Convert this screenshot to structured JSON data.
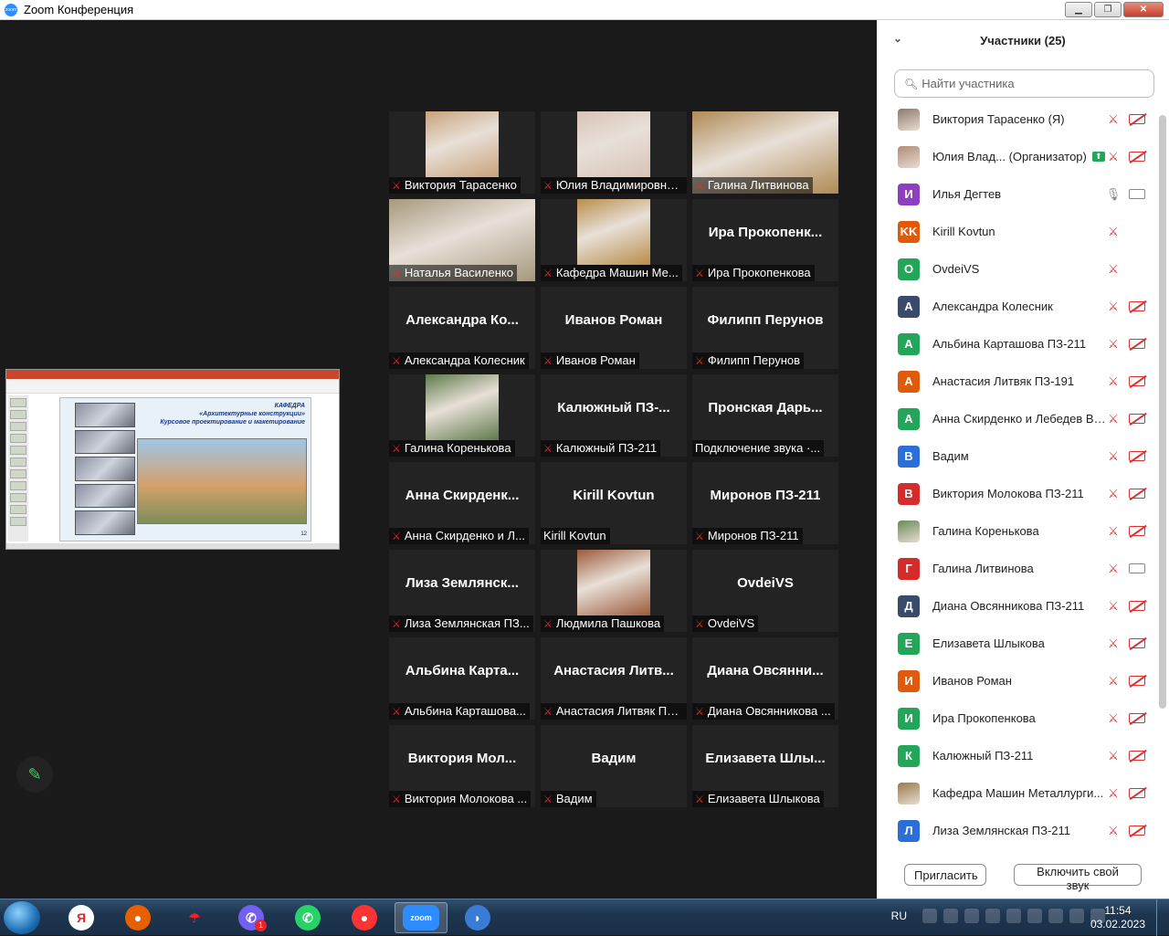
{
  "window": {
    "title": "Zoom Конференция",
    "app_icon_text": "zoom"
  },
  "shared_screen": {
    "slide_header": "КАФЕДРА",
    "slide_title": "«Архитектурные конструкции»",
    "slide_subtitle": "Курсовое проектирование и макетирование",
    "slide_number": "12"
  },
  "gallery": [
    {
      "label": "Виктория Тарасенко",
      "muted": true,
      "photo": "#c9a27a",
      "full": false
    },
    {
      "label": "Юлия Владимировна...",
      "muted": true,
      "photo": "#d8c3b6",
      "full": false
    },
    {
      "label": "Галина Литвинова",
      "muted": true,
      "photo": "#b08a55",
      "full": true
    },
    {
      "label": "Наталья Василенко",
      "muted": true,
      "photo": "#a6987e",
      "full": true
    },
    {
      "label": "Кафедра Машин Ме...",
      "muted": true,
      "photo": "#b98d4a",
      "full": false
    },
    {
      "name": "Ира  Прокопенк...",
      "label": "Ира Прокопенкова",
      "muted": true
    },
    {
      "name": "Александра  Ко...",
      "label": "Александра Колесник",
      "muted": true
    },
    {
      "name": "Иванов Роман",
      "label": "Иванов Роман",
      "muted": true
    },
    {
      "name": "Филипп Перунов",
      "label": "Филипп Перунов",
      "muted": true
    },
    {
      "label": "Галина Коренькова",
      "muted": true,
      "photo": "#5e7a4a",
      "full": false
    },
    {
      "name": "Калюжный  ПЗ-...",
      "label": "Калюжный ПЗ-211",
      "muted": true
    },
    {
      "name": "Пронская  Дарь...",
      "label": "Подключение звука ·...",
      "muted": false
    },
    {
      "name": "Анна  Скирденк...",
      "label": "Анна Скирденко и Л...",
      "muted": true
    },
    {
      "name": "Kirill Kovtun",
      "label": "Kirill Kovtun",
      "muted": false
    },
    {
      "name": "Миронов ПЗ-211",
      "label": "Миронов ПЗ-211",
      "muted": true
    },
    {
      "name": "Лиза  Землянск...",
      "label": "Лиза Землянская ПЗ...",
      "muted": true
    },
    {
      "label": "Людмила Пашкова",
      "muted": true,
      "photo": "#9b5a3a",
      "full": false
    },
    {
      "name": "OvdeiVS",
      "label": "OvdeiVS",
      "muted": true
    },
    {
      "name": "Альбина  Карта...",
      "label": "Альбина Карташова...",
      "muted": true
    },
    {
      "name": "Анастасия  Литв...",
      "label": "Анастасия Литвяк ПЗ...",
      "muted": true
    },
    {
      "name": "Диана  Овсянни...",
      "label": "Диана Овсянникова ...",
      "muted": true
    },
    {
      "name": "Виктория  Мол...",
      "label": "Виктория Молокова ...",
      "muted": true
    },
    {
      "name": "Вадим",
      "label": "Вадим",
      "muted": true
    },
    {
      "name": "Елизавета  Шлы...",
      "label": "Елизавета Шлыкова",
      "muted": true
    }
  ],
  "panel": {
    "title": "Участники (25)",
    "search_placeholder": "Найти участника",
    "invite_label": "Пригласить",
    "unmute_label": "Включить свой звук",
    "participants": [
      {
        "initials": "",
        "photo": "#8a7a6a",
        "name": "Виктория Тарасенко (Я)",
        "mic": "off",
        "cam": "off"
      },
      {
        "initials": "",
        "photo": "#b08c7a",
        "name": "Юлия Влад...  (Организатор)",
        "share": true,
        "mic": "off",
        "cam": "off"
      },
      {
        "initials": "И",
        "color": "#8e3fc0",
        "name": "Илья Дегтев",
        "mic": "on",
        "cam": "on"
      },
      {
        "initials": "KK",
        "color": "#e05a0c",
        "name": "Kirill Kovtun",
        "mic": "off",
        "cam": "none"
      },
      {
        "initials": "O",
        "color": "#23a55a",
        "name": "OvdeiVS",
        "mic": "off",
        "cam": "none"
      },
      {
        "initials": "А",
        "color": "#3a4a6a",
        "name": "Александра Колесник",
        "mic": "off",
        "cam": "off"
      },
      {
        "initials": "А",
        "color": "#23a55a",
        "name": "Альбина Карташова ПЗ-211",
        "mic": "off",
        "cam": "off"
      },
      {
        "initials": "А",
        "color": "#e05a0c",
        "name": "Анастасия Литвяк ПЗ-191",
        "mic": "off",
        "cam": "off"
      },
      {
        "initials": "А",
        "color": "#23a55a",
        "name": "Анна Скирденко и Лебедев Ви...",
        "mic": "off",
        "cam": "off"
      },
      {
        "initials": "В",
        "color": "#2b6fd6",
        "name": "Вадим",
        "mic": "off",
        "cam": "off"
      },
      {
        "initials": "В",
        "color": "#d62b2b",
        "name": "Виктория Молокова ПЗ-211",
        "mic": "off",
        "cam": "off"
      },
      {
        "initials": "",
        "photo": "#6a8a5a",
        "name": "Галина Коренькова",
        "mic": "off",
        "cam": "off"
      },
      {
        "initials": "Г",
        "color": "#d62b2b",
        "name": "Галина Литвинова",
        "mic": "off",
        "cam": "on"
      },
      {
        "initials": "Д",
        "color": "#3a4a6a",
        "name": "Диана Овсянникова ПЗ-211",
        "mic": "off",
        "cam": "off"
      },
      {
        "initials": "Е",
        "color": "#23a55a",
        "name": "Елизавета Шлыкова",
        "mic": "off",
        "cam": "off"
      },
      {
        "initials": "И",
        "color": "#e05a0c",
        "name": "Иванов Роман",
        "mic": "off",
        "cam": "off"
      },
      {
        "initials": "И",
        "color": "#23a55a",
        "name": "Ира Прокопенкова",
        "mic": "off",
        "cam": "off"
      },
      {
        "initials": "К",
        "color": "#23a55a",
        "name": "Калюжный ПЗ-211",
        "mic": "off",
        "cam": "off"
      },
      {
        "initials": "",
        "photo": "#9a7a4a",
        "name": "Кафедра Машин Металлурги...",
        "mic": "off",
        "cam": "off"
      },
      {
        "initials": "Л",
        "color": "#2b6fd6",
        "name": "Лиза Землянская ПЗ-211",
        "mic": "off",
        "cam": "off"
      }
    ]
  },
  "taskbar": {
    "apps": [
      {
        "name": "yandex-browser",
        "glyph": "Я",
        "color": "#e22",
        "bg": "#fff"
      },
      {
        "name": "firefox",
        "glyph": "●",
        "color": "#fff",
        "bg": "#e66000"
      },
      {
        "name": "umbrella",
        "glyph": "☂",
        "color": "#e22",
        "bg": "transparent"
      },
      {
        "name": "viber",
        "glyph": "✆",
        "color": "#fff",
        "bg": "#7360f2",
        "badge": "1"
      },
      {
        "name": "whatsapp",
        "glyph": "✆",
        "color": "#fff",
        "bg": "#25d366"
      },
      {
        "name": "screen-recorder",
        "glyph": "●",
        "color": "#fff",
        "bg": "#f33"
      },
      {
        "name": "zoom",
        "glyph": "zoom",
        "color": "#fff",
        "bg": "#2d8cff",
        "active": true
      },
      {
        "name": "disk-app",
        "glyph": "◗",
        "color": "#fff",
        "bg": "#3a7bd5"
      }
    ],
    "lang": "RU",
    "time": "11:54",
    "date": "03.02.2023"
  }
}
